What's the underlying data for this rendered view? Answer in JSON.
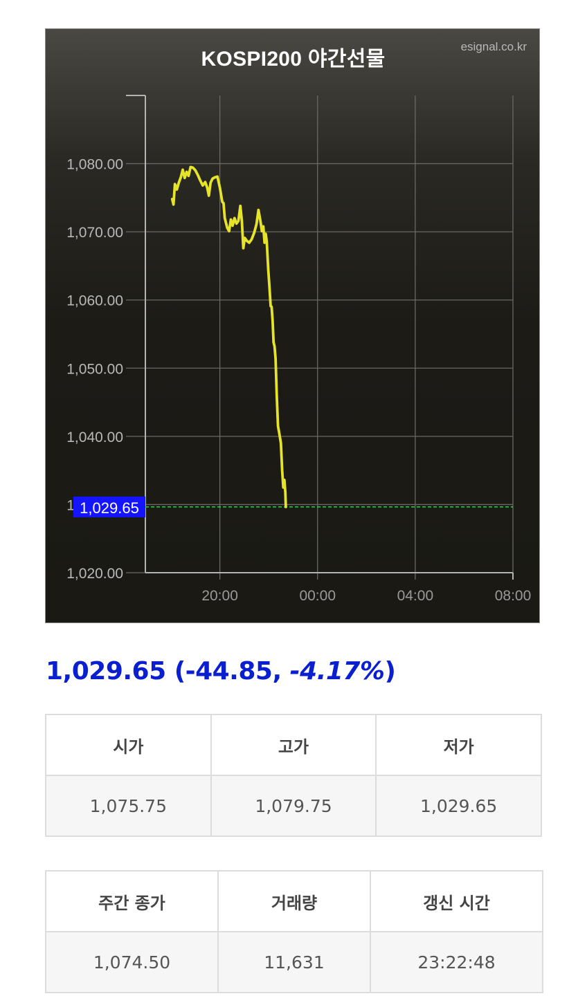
{
  "chart_data": {
    "type": "line",
    "title": "KOSPI200 야간선물",
    "source": "esignal.co.kr",
    "x_unit": "hour (0-36, 24 = 00:00 next day)",
    "xlim": [
      16.95,
      32
    ],
    "ylim": [
      1020,
      1090
    ],
    "x_ticks": [
      20,
      24,
      28,
      32
    ],
    "x_tick_labels": [
      "20:00",
      "00:00",
      "04:00",
      "08:00"
    ],
    "y_ticks": [
      1020,
      1030,
      1040,
      1050,
      1060,
      1070,
      1080
    ],
    "y_tick_labels": [
      "1,020.00",
      "1,030.00",
      "1,040.00",
      "1,050.00",
      "1,060.00",
      "1,070.00",
      "1,080.00"
    ],
    "grid": true,
    "line_color": "#e6e32b",
    "reference_color": "#2ed34a",
    "current_value": 1029.65,
    "current_label": "1,029.65",
    "label_color": "#1414ff",
    "series": [
      {
        "values": [
          [
            18.05,
            1074.8
          ],
          [
            18.1,
            1074.0
          ],
          [
            18.16,
            1077.0
          ],
          [
            18.24,
            1076.2
          ],
          [
            18.32,
            1077.2
          ],
          [
            18.4,
            1078.0
          ],
          [
            18.48,
            1079.1
          ],
          [
            18.56,
            1077.9
          ],
          [
            18.64,
            1078.8
          ],
          [
            18.72,
            1078.2
          ],
          [
            18.8,
            1079.5
          ],
          [
            18.9,
            1079.4
          ],
          [
            19.0,
            1079.0
          ],
          [
            19.1,
            1078.3
          ],
          [
            19.2,
            1077.5
          ],
          [
            19.3,
            1076.8
          ],
          [
            19.4,
            1077.3
          ],
          [
            19.48,
            1076.5
          ],
          [
            19.55,
            1075.3
          ],
          [
            19.62,
            1077.2
          ],
          [
            19.7,
            1077.8
          ],
          [
            19.8,
            1078.0
          ],
          [
            19.9,
            1078.1
          ],
          [
            20.0,
            1076.5
          ],
          [
            20.1,
            1074.4
          ],
          [
            20.15,
            1074.2
          ],
          [
            20.2,
            1072.0
          ],
          [
            20.3,
            1070.6
          ],
          [
            20.38,
            1070.1
          ],
          [
            20.45,
            1071.8
          ],
          [
            20.52,
            1070.9
          ],
          [
            20.6,
            1072.0
          ],
          [
            20.68,
            1071.2
          ],
          [
            20.76,
            1071.6
          ],
          [
            20.84,
            1073.8
          ],
          [
            20.9,
            1071.6
          ],
          [
            20.96,
            1067.6
          ],
          [
            21.02,
            1069.1
          ],
          [
            21.1,
            1068.7
          ],
          [
            21.2,
            1068.4
          ],
          [
            21.3,
            1068.9
          ],
          [
            21.4,
            1069.8
          ],
          [
            21.5,
            1071.1
          ],
          [
            21.58,
            1073.2
          ],
          [
            21.66,
            1071.6
          ],
          [
            21.72,
            1070.1
          ],
          [
            21.78,
            1070.8
          ],
          [
            21.83,
            1068.4
          ],
          [
            21.88,
            1069.7
          ],
          [
            21.92,
            1068.5
          ],
          [
            21.98,
            1064.5
          ],
          [
            22.03,
            1062.0
          ],
          [
            22.08,
            1059.1
          ],
          [
            22.12,
            1059.0
          ],
          [
            22.16,
            1057.0
          ],
          [
            22.2,
            1053.8
          ],
          [
            22.24,
            1053.2
          ],
          [
            22.28,
            1051.4
          ],
          [
            22.33,
            1046.0
          ],
          [
            22.38,
            1041.5
          ],
          [
            22.44,
            1040.3
          ],
          [
            22.5,
            1039.0
          ],
          [
            22.55,
            1035.0
          ],
          [
            22.6,
            1032.5
          ],
          [
            22.64,
            1033.6
          ],
          [
            22.68,
            1031.8
          ],
          [
            22.7,
            1029.65
          ]
        ]
      }
    ]
  },
  "summary": {
    "price": "1,029.65",
    "change_open": " (-44.85, ",
    "change_pct": "-4.17%",
    "close_paren": ")"
  },
  "table_ohl": {
    "headers": [
      "시가",
      "고가",
      "저가"
    ],
    "values": [
      "1,075.75",
      "1,079.75",
      "1,029.65"
    ]
  },
  "table_extra": {
    "headers": [
      "주간 종가",
      "거래량",
      "갱신 시간"
    ],
    "values": [
      "1,074.50",
      "11,631",
      "23:22:48"
    ]
  }
}
